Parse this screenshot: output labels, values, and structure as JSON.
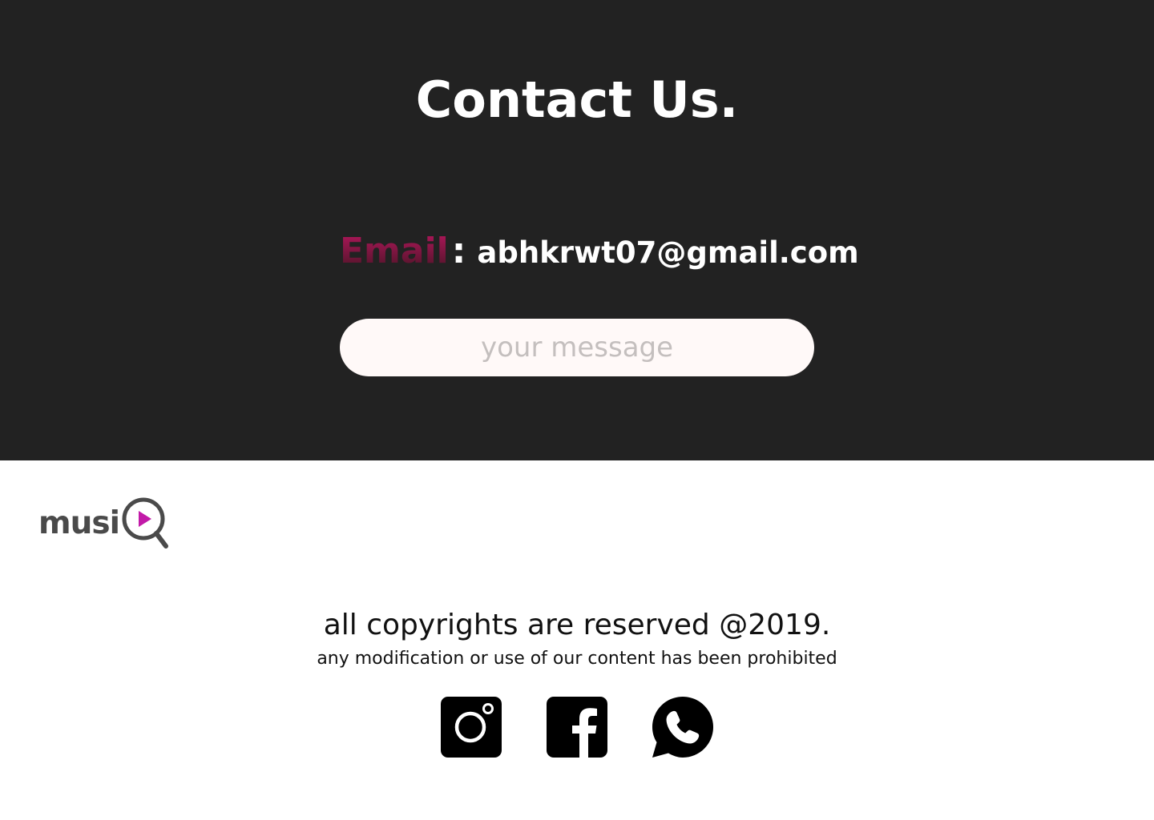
{
  "contact": {
    "title": "Contact Us.",
    "email_label": "Email",
    "email_colon": ":",
    "email_value": "abhkrwt07@gmail.com",
    "message_placeholder": "your message"
  },
  "footer": {
    "logo_text": "musi",
    "copyright": "all copyrights are reserved @2019.",
    "notice": "any modification or use of our content has been prohibited",
    "socials": [
      {
        "icon": "instagram-icon"
      },
      {
        "icon": "facebook-icon"
      },
      {
        "icon": "whatsapp-icon"
      }
    ]
  },
  "colors": {
    "dark_bg": "#222222",
    "accent": "#b3175c",
    "logo_play": "#c21aa8"
  }
}
